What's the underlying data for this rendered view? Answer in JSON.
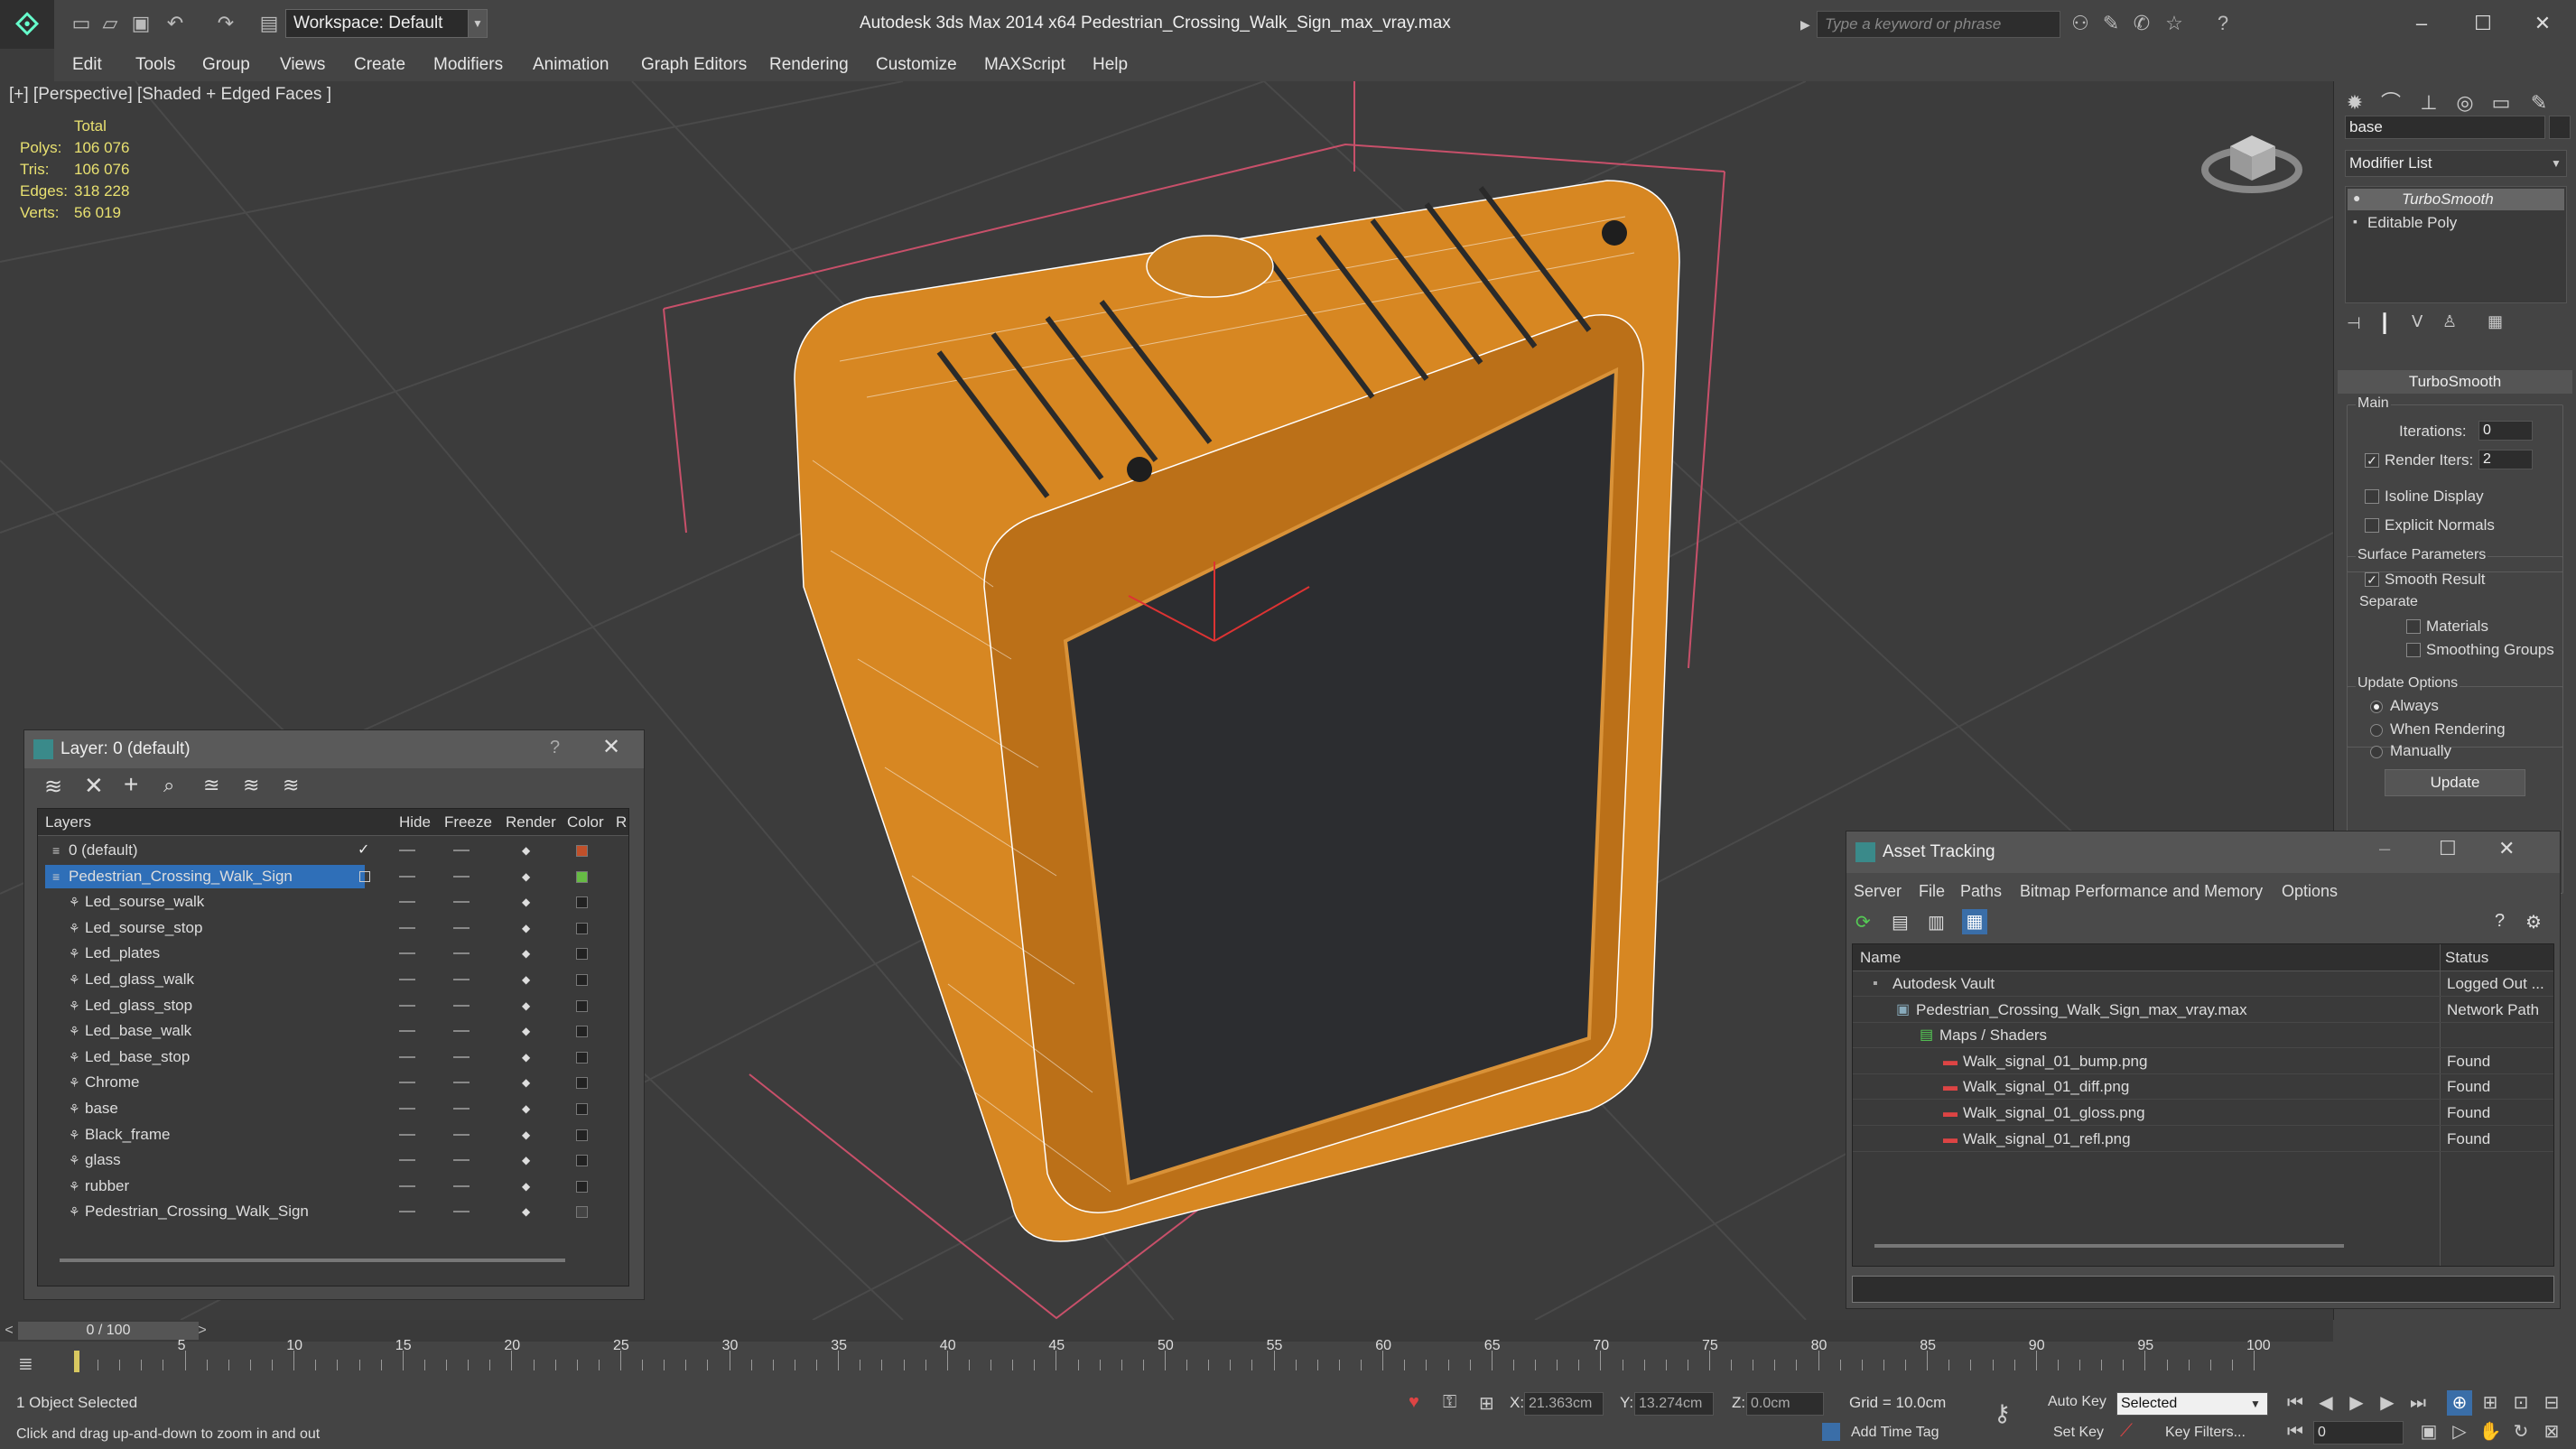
{
  "app": {
    "workspace": "Workspace: Default",
    "title": "Autodesk 3ds Max  2014 x64      Pedestrian_Crossing_Walk_Sign_max_vray.max",
    "search_placeholder": "Type a keyword or phrase"
  },
  "menu": [
    "Edit",
    "Tools",
    "Group",
    "Views",
    "Create",
    "Modifiers",
    "Animation",
    "Graph Editors",
    "Rendering",
    "Customize",
    "MAXScript",
    "Help"
  ],
  "viewport": {
    "label": "[+] [Perspective] [Shaded + Edged Faces ]",
    "stats": {
      "header": "Total",
      "rows": [
        {
          "label": "Polys:",
          "value": "106 076"
        },
        {
          "label": "Tris:",
          "value": "106 076"
        },
        {
          "label": "Edges:",
          "value": "318 228"
        },
        {
          "label": "Verts:",
          "value": "56 019"
        }
      ]
    }
  },
  "command_panel": {
    "object_name": "base",
    "modifier_list": "Modifier List",
    "stack": [
      "TurboSmooth",
      "Editable Poly"
    ],
    "rollout_title": "TurboSmooth",
    "main_label": "Main",
    "iterations_label": "Iterations:",
    "iterations_value": "0",
    "render_iters_label": "Render Iters:",
    "render_iters_value": "2",
    "isoline": "Isoline Display",
    "explicit": "Explicit Normals",
    "surface_label": "Surface Parameters",
    "smooth_result": "Smooth Result",
    "separate_label": "Separate",
    "materials": "Materials",
    "smoothing_groups": "Smoothing Groups",
    "update_label": "Update Options",
    "always": "Always",
    "when_rendering": "When Rendering",
    "manually": "Manually",
    "update_button": "Update"
  },
  "layer_dialog": {
    "title": "Layer: 0 (default)",
    "help": "?",
    "headers": {
      "layers": "Layers",
      "hide": "Hide",
      "freeze": "Freeze",
      "render": "Render",
      "color": "Color",
      "r": "R"
    },
    "rows": [
      {
        "name": "0 (default)",
        "color": "#c0502a",
        "level": 0
      },
      {
        "name": "Pedestrian_Crossing_Walk_Sign",
        "color": "#66bb44",
        "level": 0,
        "selected": true
      },
      {
        "name": "Led_sourse_walk",
        "color": "#222222",
        "level": 1
      },
      {
        "name": "Led_sourse_stop",
        "color": "#222222",
        "level": 1
      },
      {
        "name": "Led_plates",
        "color": "#222222",
        "level": 1
      },
      {
        "name": "Led_glass_walk",
        "color": "#222222",
        "level": 1
      },
      {
        "name": "Led_glass_stop",
        "color": "#222222",
        "level": 1
      },
      {
        "name": "Led_base_walk",
        "color": "#222222",
        "level": 1
      },
      {
        "name": "Led_base_stop",
        "color": "#222222",
        "level": 1
      },
      {
        "name": "Chrome",
        "color": "#222222",
        "level": 1
      },
      {
        "name": "base",
        "color": "#222222",
        "level": 1
      },
      {
        "name": "Black_frame",
        "color": "#222222",
        "level": 1
      },
      {
        "name": "glass",
        "color": "#222222",
        "level": 1
      },
      {
        "name": "rubber",
        "color": "#222222",
        "level": 1
      },
      {
        "name": "Pedestrian_Crossing_Walk_Sign",
        "color": "#444444",
        "level": 1
      }
    ]
  },
  "asset_dialog": {
    "title": "Asset Tracking",
    "menu": [
      "Server",
      "File",
      "Paths",
      "Bitmap Performance and Memory",
      "Options"
    ],
    "headers": {
      "name": "Name",
      "status": "Status"
    },
    "rows": [
      {
        "name": "Autodesk Vault",
        "status": "Logged Out ...",
        "level": 0
      },
      {
        "name": "Pedestrian_Crossing_Walk_Sign_max_vray.max",
        "status": "Network Path",
        "level": 1
      },
      {
        "name": "Maps / Shaders",
        "status": "",
        "level": 2
      },
      {
        "name": "Walk_signal_01_bump.png",
        "status": "Found",
        "level": 3
      },
      {
        "name": "Walk_signal_01_diff.png",
        "status": "Found",
        "level": 3
      },
      {
        "name": "Walk_signal_01_gloss.png",
        "status": "Found",
        "level": 3
      },
      {
        "name": "Walk_signal_01_refl.png",
        "status": "Found",
        "level": 3
      }
    ]
  },
  "timeline": {
    "frame": "0 / 100",
    "ticks": [
      "5",
      "10",
      "15",
      "20",
      "25",
      "30",
      "35",
      "40",
      "45",
      "50",
      "55",
      "60",
      "65",
      "70",
      "75",
      "80",
      "85",
      "90",
      "95",
      "100"
    ]
  },
  "status": {
    "selected": "1 Object Selected",
    "hint": "Click and drag up-and-down to zoom in and out",
    "x_label": "X:",
    "x_value": "21.363cm",
    "y_label": "Y:",
    "y_value": "13.274cm",
    "z_label": "Z:",
    "z_value": "0.0cm",
    "grid": "Grid = 10.0cm",
    "auto_key": "Auto Key",
    "selected_dropdown": "Selected",
    "set_key": "Set Key",
    "key_filters": "Key Filters...",
    "add_time_tag": "Add Time Tag",
    "frame_field": "0"
  }
}
